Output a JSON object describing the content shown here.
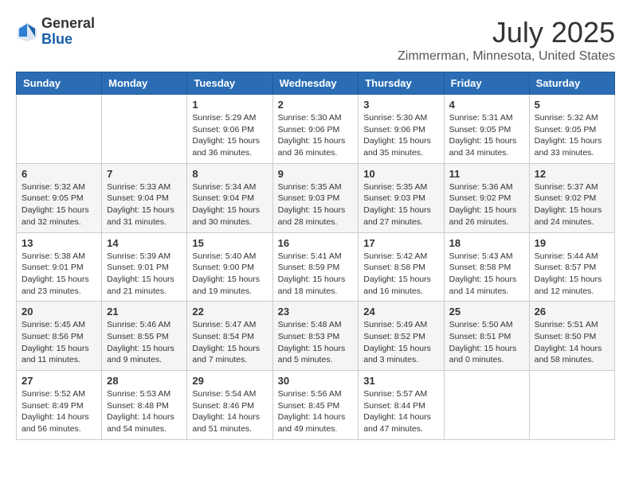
{
  "header": {
    "logo_general": "General",
    "logo_blue": "Blue",
    "month_year": "July 2025",
    "location": "Zimmerman, Minnesota, United States"
  },
  "weekdays": [
    "Sunday",
    "Monday",
    "Tuesday",
    "Wednesday",
    "Thursday",
    "Friday",
    "Saturday"
  ],
  "weeks": [
    [
      {
        "day": "",
        "info": ""
      },
      {
        "day": "",
        "info": ""
      },
      {
        "day": "1",
        "info": "Sunrise: 5:29 AM\nSunset: 9:06 PM\nDaylight: 15 hours and 36 minutes."
      },
      {
        "day": "2",
        "info": "Sunrise: 5:30 AM\nSunset: 9:06 PM\nDaylight: 15 hours and 36 minutes."
      },
      {
        "day": "3",
        "info": "Sunrise: 5:30 AM\nSunset: 9:06 PM\nDaylight: 15 hours and 35 minutes."
      },
      {
        "day": "4",
        "info": "Sunrise: 5:31 AM\nSunset: 9:05 PM\nDaylight: 15 hours and 34 minutes."
      },
      {
        "day": "5",
        "info": "Sunrise: 5:32 AM\nSunset: 9:05 PM\nDaylight: 15 hours and 33 minutes."
      }
    ],
    [
      {
        "day": "6",
        "info": "Sunrise: 5:32 AM\nSunset: 9:05 PM\nDaylight: 15 hours and 32 minutes."
      },
      {
        "day": "7",
        "info": "Sunrise: 5:33 AM\nSunset: 9:04 PM\nDaylight: 15 hours and 31 minutes."
      },
      {
        "day": "8",
        "info": "Sunrise: 5:34 AM\nSunset: 9:04 PM\nDaylight: 15 hours and 30 minutes."
      },
      {
        "day": "9",
        "info": "Sunrise: 5:35 AM\nSunset: 9:03 PM\nDaylight: 15 hours and 28 minutes."
      },
      {
        "day": "10",
        "info": "Sunrise: 5:35 AM\nSunset: 9:03 PM\nDaylight: 15 hours and 27 minutes."
      },
      {
        "day": "11",
        "info": "Sunrise: 5:36 AM\nSunset: 9:02 PM\nDaylight: 15 hours and 26 minutes."
      },
      {
        "day": "12",
        "info": "Sunrise: 5:37 AM\nSunset: 9:02 PM\nDaylight: 15 hours and 24 minutes."
      }
    ],
    [
      {
        "day": "13",
        "info": "Sunrise: 5:38 AM\nSunset: 9:01 PM\nDaylight: 15 hours and 23 minutes."
      },
      {
        "day": "14",
        "info": "Sunrise: 5:39 AM\nSunset: 9:01 PM\nDaylight: 15 hours and 21 minutes."
      },
      {
        "day": "15",
        "info": "Sunrise: 5:40 AM\nSunset: 9:00 PM\nDaylight: 15 hours and 19 minutes."
      },
      {
        "day": "16",
        "info": "Sunrise: 5:41 AM\nSunset: 8:59 PM\nDaylight: 15 hours and 18 minutes."
      },
      {
        "day": "17",
        "info": "Sunrise: 5:42 AM\nSunset: 8:58 PM\nDaylight: 15 hours and 16 minutes."
      },
      {
        "day": "18",
        "info": "Sunrise: 5:43 AM\nSunset: 8:58 PM\nDaylight: 15 hours and 14 minutes."
      },
      {
        "day": "19",
        "info": "Sunrise: 5:44 AM\nSunset: 8:57 PM\nDaylight: 15 hours and 12 minutes."
      }
    ],
    [
      {
        "day": "20",
        "info": "Sunrise: 5:45 AM\nSunset: 8:56 PM\nDaylight: 15 hours and 11 minutes."
      },
      {
        "day": "21",
        "info": "Sunrise: 5:46 AM\nSunset: 8:55 PM\nDaylight: 15 hours and 9 minutes."
      },
      {
        "day": "22",
        "info": "Sunrise: 5:47 AM\nSunset: 8:54 PM\nDaylight: 15 hours and 7 minutes."
      },
      {
        "day": "23",
        "info": "Sunrise: 5:48 AM\nSunset: 8:53 PM\nDaylight: 15 hours and 5 minutes."
      },
      {
        "day": "24",
        "info": "Sunrise: 5:49 AM\nSunset: 8:52 PM\nDaylight: 15 hours and 3 minutes."
      },
      {
        "day": "25",
        "info": "Sunrise: 5:50 AM\nSunset: 8:51 PM\nDaylight: 15 hours and 0 minutes."
      },
      {
        "day": "26",
        "info": "Sunrise: 5:51 AM\nSunset: 8:50 PM\nDaylight: 14 hours and 58 minutes."
      }
    ],
    [
      {
        "day": "27",
        "info": "Sunrise: 5:52 AM\nSunset: 8:49 PM\nDaylight: 14 hours and 56 minutes."
      },
      {
        "day": "28",
        "info": "Sunrise: 5:53 AM\nSunset: 8:48 PM\nDaylight: 14 hours and 54 minutes."
      },
      {
        "day": "29",
        "info": "Sunrise: 5:54 AM\nSunset: 8:46 PM\nDaylight: 14 hours and 51 minutes."
      },
      {
        "day": "30",
        "info": "Sunrise: 5:56 AM\nSunset: 8:45 PM\nDaylight: 14 hours and 49 minutes."
      },
      {
        "day": "31",
        "info": "Sunrise: 5:57 AM\nSunset: 8:44 PM\nDaylight: 14 hours and 47 minutes."
      },
      {
        "day": "",
        "info": ""
      },
      {
        "day": "",
        "info": ""
      }
    ]
  ]
}
